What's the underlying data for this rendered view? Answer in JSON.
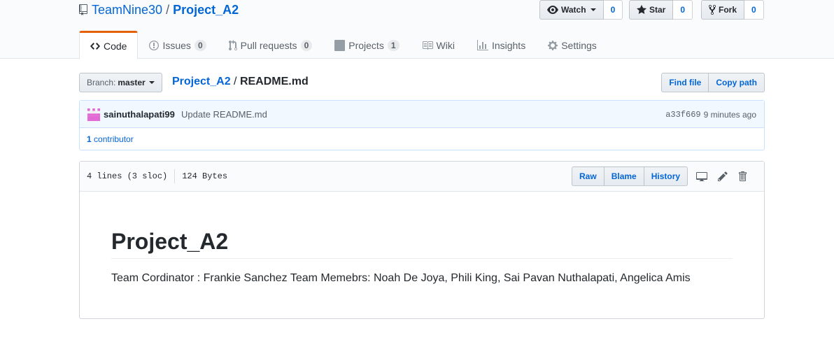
{
  "repo": {
    "owner": "TeamNine30",
    "separator": "/",
    "name": "Project_A2"
  },
  "actions": {
    "watch": {
      "label": "Watch",
      "count": "0"
    },
    "star": {
      "label": "Star",
      "count": "0"
    },
    "fork": {
      "label": "Fork",
      "count": "0"
    }
  },
  "tabs": [
    {
      "label": "Code",
      "icon": "code-icon"
    },
    {
      "label": "Issues",
      "count": "0",
      "icon": "issue-icon"
    },
    {
      "label": "Pull requests",
      "count": "0",
      "icon": "pull-request-icon"
    },
    {
      "label": "Projects",
      "count": "1",
      "icon": "project-icon"
    },
    {
      "label": "Wiki",
      "icon": "book-icon"
    },
    {
      "label": "Insights",
      "icon": "graph-icon"
    },
    {
      "label": "Settings",
      "icon": "gear-icon"
    }
  ],
  "branch": {
    "label": "Branch:",
    "value": "master"
  },
  "breadcrumb": {
    "root": "Project_A2",
    "separator": "/",
    "file": "README.md"
  },
  "file_nav": {
    "find_file": "Find file",
    "copy_path": "Copy path"
  },
  "commit": {
    "author": "sainuthalapati99",
    "message": "Update README.md",
    "sha": "a33f669",
    "time": "9 minutes ago"
  },
  "contributors": {
    "count": "1",
    "label": "contributor"
  },
  "file": {
    "lines": "4 lines (3 sloc)",
    "size": "124 Bytes",
    "raw": "Raw",
    "blame": "Blame",
    "history": "History"
  },
  "readme": {
    "heading": "Project_A2",
    "body": "Team Cordinator : Frankie Sanchez Team Memebrs: Noah De Joya, Phili King, Sai Pavan Nuthalapati, Angelica Amis"
  },
  "colors": {
    "link": "#0366d6",
    "tab_accent": "#e36209",
    "commit_bg": "#f1f8ff",
    "avatar": "#e36ad5"
  }
}
